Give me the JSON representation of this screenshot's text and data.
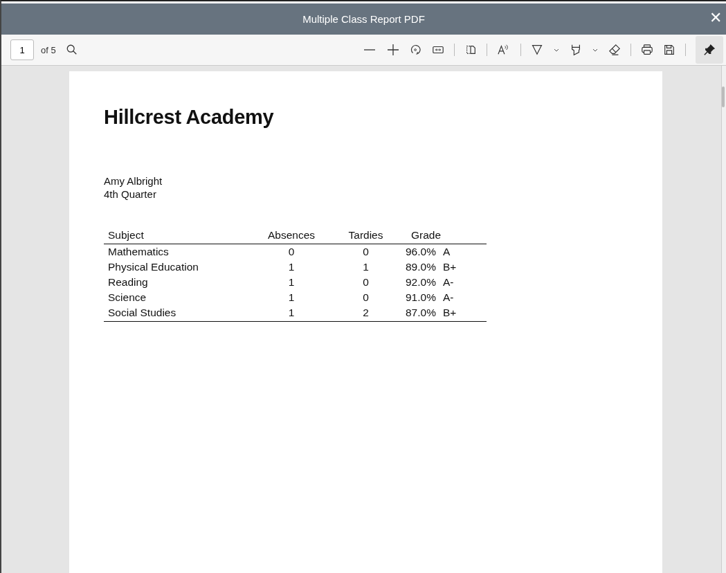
{
  "window": {
    "title": "Multiple Class Report PDF",
    "close": "✕"
  },
  "toolbar": {
    "page": "1",
    "page_count": "of 5",
    "pinned": true
  },
  "document": {
    "school": "Hillcrest Academy",
    "student": "Amy Albright",
    "term": "4th Quarter",
    "table": {
      "columns": [
        "Subject",
        "Absences",
        "Tardies",
        "Grade"
      ],
      "rows": [
        {
          "subject": "Mathematics",
          "absences": "0",
          "tardies": "0",
          "percent": "96.0%",
          "letter": "A"
        },
        {
          "subject": "Physical Education",
          "absences": "1",
          "tardies": "1",
          "percent": "89.0%",
          "letter": "B+"
        },
        {
          "subject": "Reading",
          "absences": "1",
          "tardies": "0",
          "percent": "92.0%",
          "letter": "A-"
        },
        {
          "subject": "Science",
          "absences": "1",
          "tardies": "0",
          "percent": "91.0%",
          "letter": "A-"
        },
        {
          "subject": "Social Studies",
          "absences": "1",
          "tardies": "2",
          "percent": "87.0%",
          "letter": "B+"
        }
      ]
    }
  }
}
